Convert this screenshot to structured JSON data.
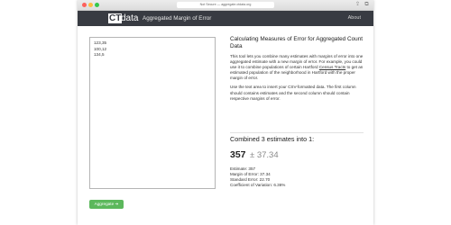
{
  "browser": {
    "address": "Not Secure — aggregate.ctdata.org"
  },
  "navbar": {
    "logo_ct": "CT",
    "logo_data": "data",
    "title": "Aggregated Margin of Error",
    "about_label": "About"
  },
  "input": {
    "lines": [
      "123,35",
      "100,12",
      "134,5"
    ]
  },
  "button": {
    "aggregate_label": "Aggregate ➔"
  },
  "info": {
    "heading": "Calculating Measures of Error for Aggregated Count Data",
    "para1_before": "This tool lets you combine many estimates with margins of error into one aggregated estimate with a new margin of error. For example, you could use it to combine populations of certain Hartford ",
    "para1_link": "Census Tracts",
    "para1_after": " to get an estimated population of the neighborhood in Hartford with the proper margin of error.",
    "para2": "Use the text area to insert your CSV-formatted data. The first column should contains estimates and the second column should contain respective margins of error."
  },
  "result": {
    "combined_text": "Combined 3 estimates into 1:",
    "estimate": "357",
    "plus_minus": "± 37.34",
    "stats": [
      "Estimate: 357",
      "Margin of Error: 37.34",
      "Standard Error: 22.70",
      "Coefficient of Variation: 6.36%"
    ]
  },
  "colors": {
    "navbar_bg": "#383b42",
    "button_bg": "#5cb85c",
    "pm_text": "#8a8a8a"
  },
  "icons": {
    "share": "share-icon",
    "tabs": "tabs-icon"
  }
}
